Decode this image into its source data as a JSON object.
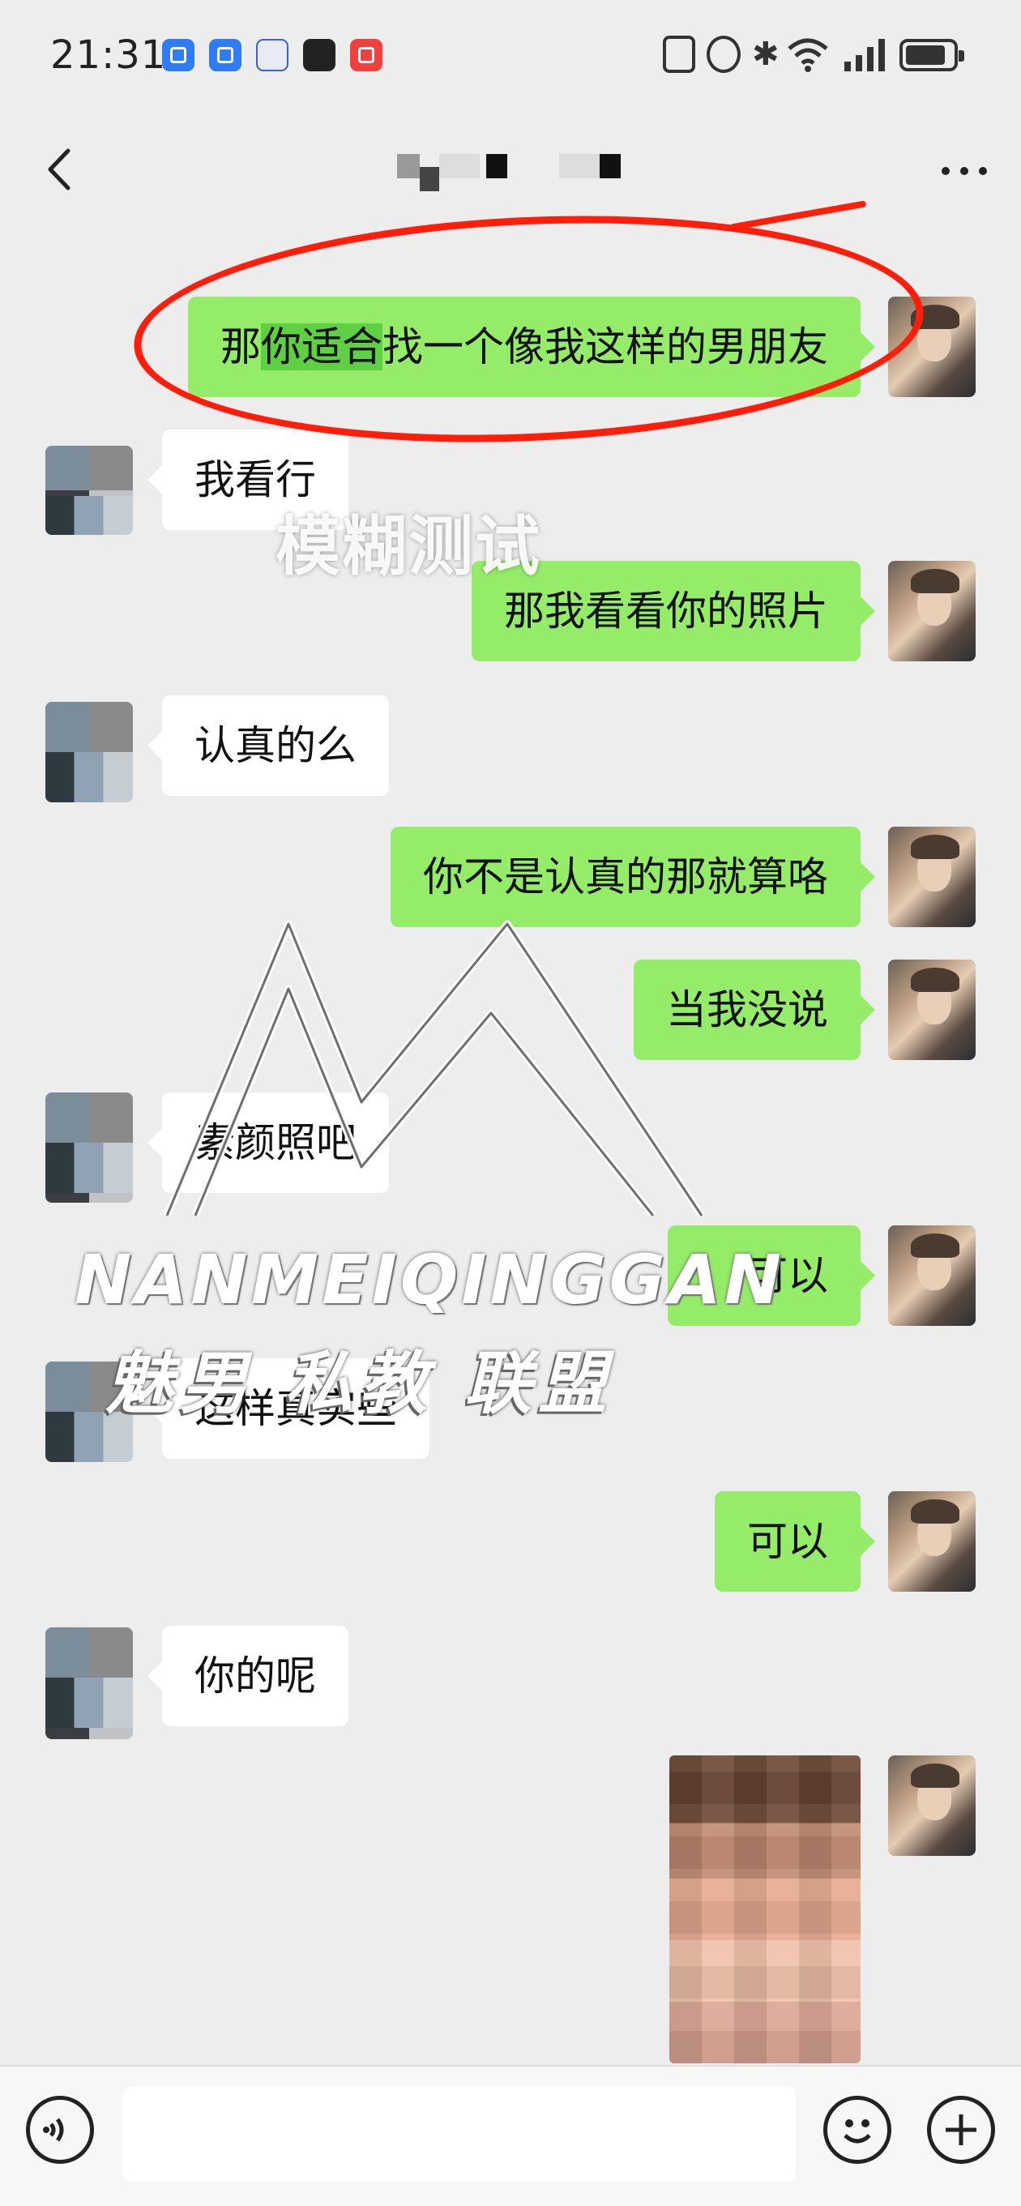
{
  "status_bar": {
    "time": "21:31",
    "bluetooth_glyph": "✱",
    "battery_level": 0.85
  },
  "header": {
    "back_icon": "chevron-left-icon",
    "more_icon": "more-dots-icon"
  },
  "messages": [
    {
      "from": "me",
      "text_pre": "那",
      "text_hl": "你适合",
      "text_post": "找一个像我这样的男朋友"
    },
    {
      "from": "them",
      "text": "我看行"
    },
    {
      "from": "me",
      "text": "那我看看你的照片"
    },
    {
      "from": "them",
      "text": "认真的么"
    },
    {
      "from": "me",
      "text": "你不是认真的那就算咯"
    },
    {
      "from": "me",
      "text": "当我没说"
    },
    {
      "from": "them",
      "text": "素颜照吧"
    },
    {
      "from": "me",
      "text": "可以"
    },
    {
      "from": "them",
      "text": "这样真实些"
    },
    {
      "from": "me",
      "text": "可以"
    },
    {
      "from": "them",
      "text": "你的呢"
    },
    {
      "from": "me",
      "type": "image"
    }
  ],
  "watermarks": {
    "test": "模糊测试",
    "brand_en": "NANMEIQINGGAN",
    "brand_cn": "魅男 私教 联盟"
  },
  "input": {
    "value": ""
  },
  "colors": {
    "my_bubble": "#95ec69",
    "their_bubble": "#ffffff",
    "background": "#ededed",
    "annotation": "#ff1e0a"
  }
}
